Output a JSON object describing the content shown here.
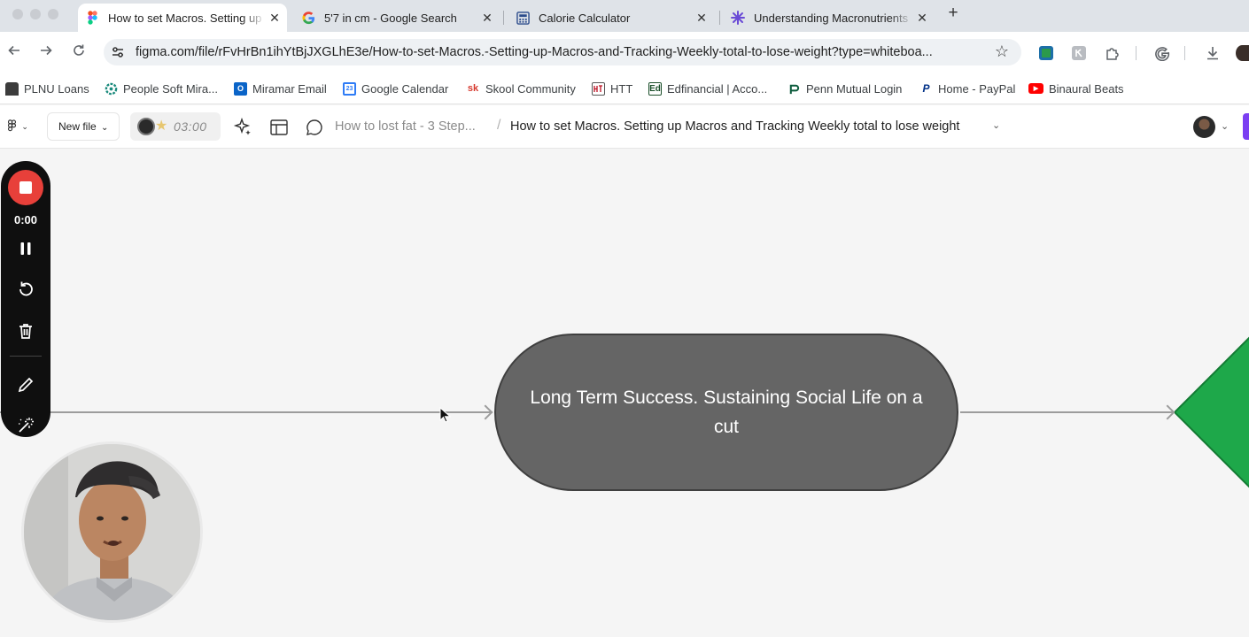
{
  "browser": {
    "tabs": [
      {
        "title": "How to set Macros. Setting up Macros and Tracking Weekly total to lose weight",
        "icon": "figma-icon",
        "active": true,
        "close": "✕"
      },
      {
        "title": "5'7 in cm - Google Search",
        "icon": "google-icon",
        "active": false,
        "close": "✕"
      },
      {
        "title": "Calorie Calculator",
        "icon": "calculator-icon",
        "active": false,
        "close": "✕"
      },
      {
        "title": "Understanding Macronutrients",
        "icon": "asterisk-icon",
        "active": false,
        "close": "✕"
      }
    ],
    "new_tab": "+",
    "url": "figma.com/file/rFvHrBn1ihYtBjJXGLhE3e/How-to-set-Macros.-Setting-up-Macros-and-Tracking-Weekly-total-to-lose-weight?type=whiteboa..."
  },
  "bookmarks": [
    {
      "label": "PLNU Loans",
      "icon": "bank-icon",
      "color": "#3c3c3c",
      "glyph": ""
    },
    {
      "label": "People Soft Mira...",
      "icon": "gear-flower-icon",
      "color": "#1a8a7c",
      "glyph": ""
    },
    {
      "label": "Miramar Email",
      "icon": "outlook-icon",
      "color": "#0a64c8",
      "glyph": "O"
    },
    {
      "label": "Google Calendar",
      "icon": "calendar-icon",
      "color": "#2f7cf6",
      "glyph": "23"
    },
    {
      "label": "Skool Community",
      "icon": "skool-icon",
      "color": "#ffffff",
      "glyph": "sk"
    },
    {
      "label": "HTT",
      "icon": "htt-icon",
      "color": "#ffffff",
      "glyph": ""
    },
    {
      "label": "Edfinancial | Acco...",
      "icon": "edfinancial-icon",
      "color": "#ffffff",
      "glyph": "Ed"
    },
    {
      "label": "Penn Mutual Login",
      "icon": "penn-mutual-icon",
      "color": "#ffffff",
      "glyph": ""
    },
    {
      "label": "Home - PayPal",
      "icon": "paypal-icon",
      "color": "#ffffff",
      "glyph": "P"
    },
    {
      "label": "Binaural Beats",
      "icon": "youtube-icon",
      "color": "#ff0000",
      "glyph": "▶"
    }
  ],
  "figma": {
    "new_file": "New file",
    "timer": "03:00",
    "breadcrumb_parent": "How to lost fat - 3 Step...",
    "breadcrumb_sep": "/",
    "file_title": "How to set Macros. Setting up Macros and Tracking Weekly total to lose weight"
  },
  "canvas": {
    "node_text": "Long Term Success. Sustaining Social Life on a cut",
    "node_color": "#656565",
    "diamond_color": "#1ea84a"
  },
  "recorder": {
    "elapsed": "0:00",
    "stop_color": "#e8403a"
  }
}
